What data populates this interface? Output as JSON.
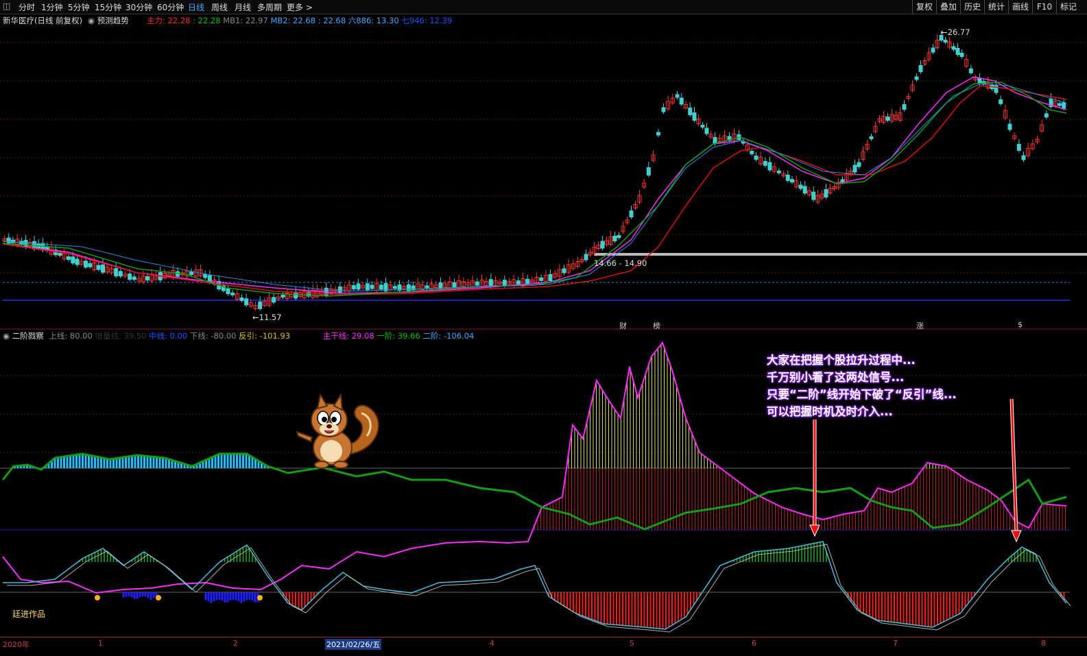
{
  "toolbar": {
    "periods": [
      "分时",
      "1分钟",
      "5分钟",
      "15分钟",
      "30分钟",
      "60分钟",
      "日线",
      "周线",
      "月线",
      "多周期",
      "更多 >"
    ],
    "active_period": "日线",
    "right_buttons": [
      "复权",
      "叠加",
      "历史",
      "统计",
      "画线",
      "F10",
      "标记"
    ]
  },
  "main_pane": {
    "title": "新华医疗(日线 前复权)",
    "forecast_label": "预测趋势",
    "indicators": [
      {
        "label": "主力: 22.28",
        "color": "#ff2a2a"
      },
      {
        "label": ": 22.28",
        "color": "#00c000"
      },
      {
        "label": "MB1: 22.97",
        "color": "#888888"
      },
      {
        "label": "MB2: 22.68",
        "color": "#3fa9ff"
      },
      {
        "label": ": 22.68",
        "color": "#3fa9ff"
      },
      {
        "label": "六886: 13.30",
        "color": "#3fa9ff"
      },
      {
        "label": "七946: 12.39",
        "color": "#1e50ff"
      }
    ],
    "high_label": "26.77",
    "low_label": "11.57",
    "range_label": "14.66 - 14.90",
    "events": [
      {
        "text": "财",
        "color": "#3fa9ff"
      },
      {
        "text": "榜",
        "color": "#ff8c00"
      },
      {
        "text": "涨",
        "color": "#ff3030"
      },
      {
        "text": "$",
        "color": "#ff3030"
      }
    ]
  },
  "sub_pane": {
    "title": "二阶戮察",
    "indicators": [
      {
        "label": "上线: 80.00",
        "color": "#888888"
      },
      {
        "label": "增量线: 39.50",
        "color": "#333333"
      },
      {
        "label": "中线: 0.00",
        "color": "#1e50ff"
      },
      {
        "label": "下线: -80.00",
        "color": "#888888"
      },
      {
        "label": "反引: -101.93",
        "color": "#e0c000"
      },
      {
        "label": "主干线: 29.08",
        "color": "#ff2aff"
      },
      {
        "label": "一阶: 39.66",
        "color": "#00c000"
      },
      {
        "label": "二阶: -106.04",
        "color": "#3fa9ff"
      }
    ],
    "author": "廷进作品",
    "callout_lines": [
      "大家在把握个股拉升过程中...",
      "千万别小看了这两处信号...",
      "只要“二阶”线开始下破了“反引”线...",
      "可以把握时机及时介入..."
    ]
  },
  "time_axis": {
    "labels": [
      "2020年",
      "1",
      "2",
      "2021/02/26/五",
      "4",
      "5",
      "6",
      "7",
      "8"
    ]
  },
  "colors": {
    "up_candle": "#ff3030",
    "down_candle": "#40d0d0",
    "ma_magenta": "#ff2aff",
    "ma_red": "#e01010",
    "ma_green": "#10a010",
    "ma_blue": "#2090e0"
  }
}
